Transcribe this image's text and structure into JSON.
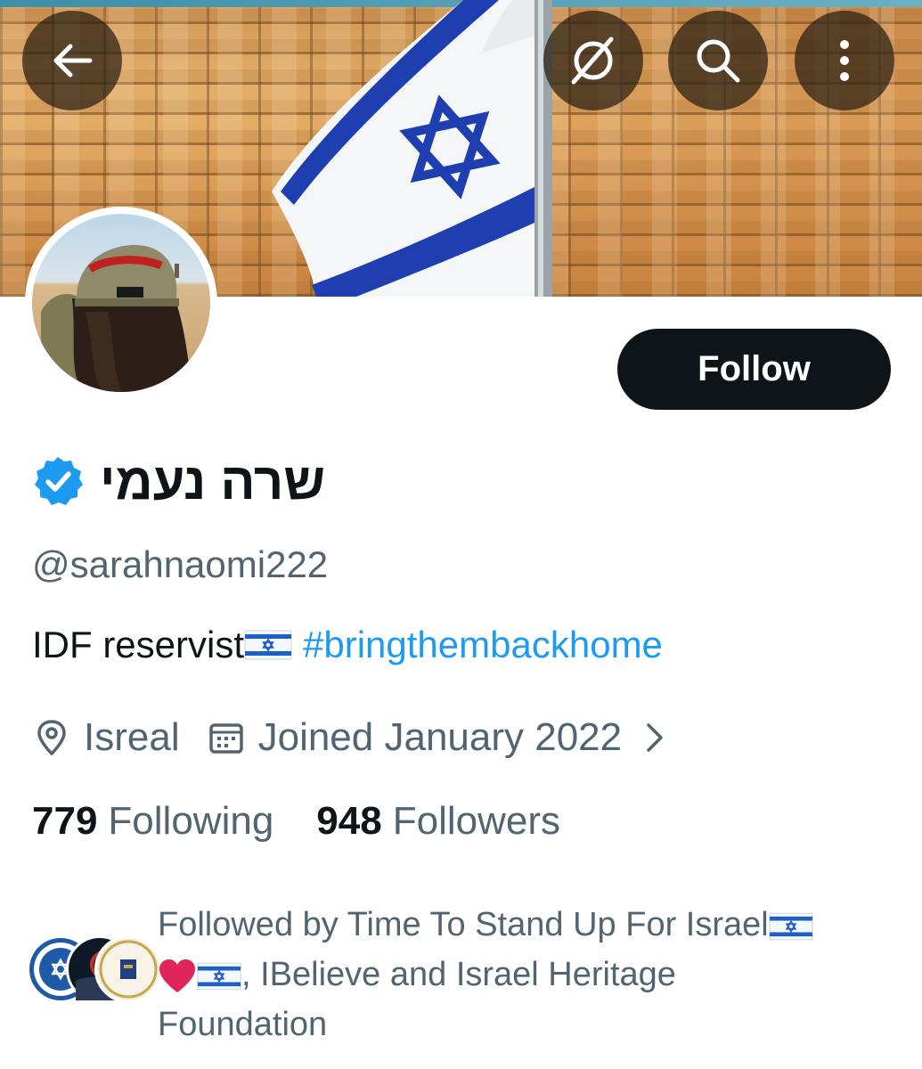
{
  "header": {
    "back_icon": "arrow-left-icon",
    "grok_icon": "grok-icon",
    "search_icon": "search-icon",
    "more_icon": "more-vertical-icon"
  },
  "profile": {
    "follow_label": "Follow",
    "display_name": "שרה נעמי",
    "verified": true,
    "handle": "@sarahnaomi222",
    "bio_text": "IDF reservist",
    "bio_hashtag": "#bringthembackhome",
    "location": "Isreal",
    "joined": "Joined January 2022",
    "following_count": "779",
    "following_label": "Following",
    "followers_count": "948",
    "followers_label": "Followers"
  },
  "followed_by": {
    "line1": "Followed by Time To Stand Up For Israel",
    "line2_suffix": ", IBelieve and Israel Heritage",
    "line3": "Foundation"
  },
  "colors": {
    "accent": "#1d9bf0",
    "text_primary": "#0f1419",
    "text_secondary": "#536471",
    "heart": "#e0245e"
  }
}
